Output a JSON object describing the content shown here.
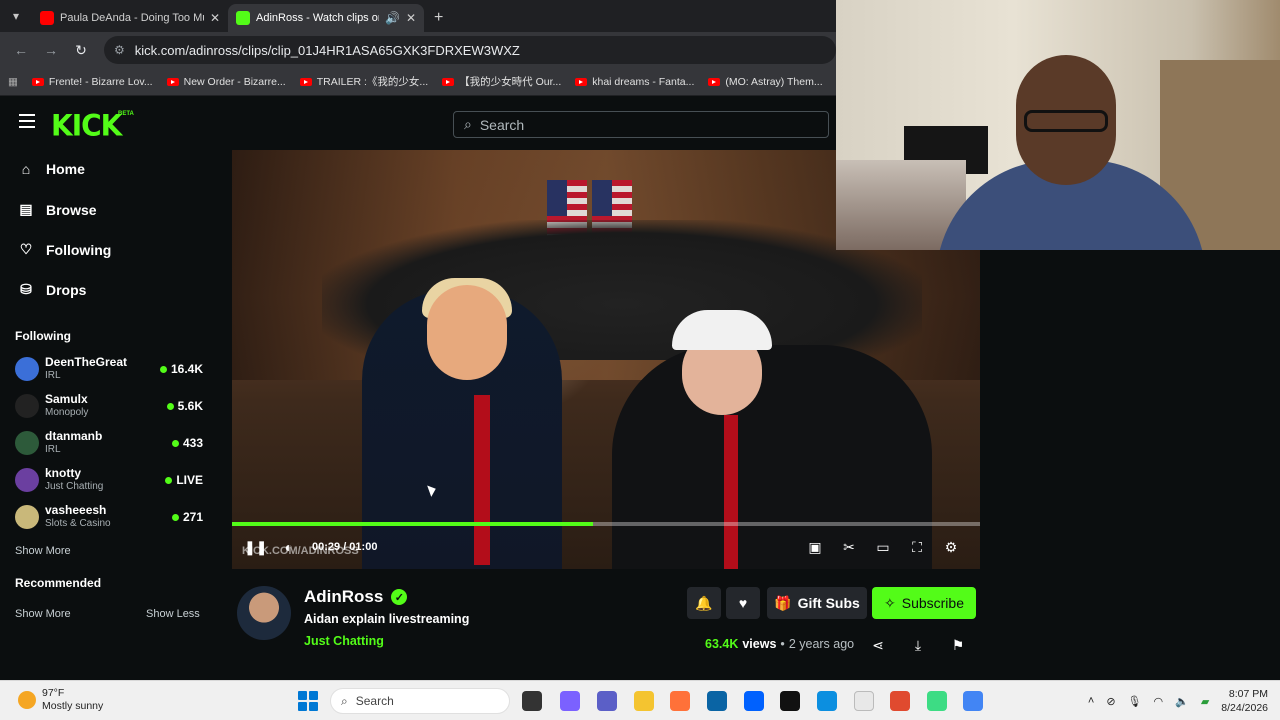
{
  "browser": {
    "tabs": [
      {
        "title": "Paula DeAnda - Doing Too Muc",
        "favicon_color": "#ff0000"
      },
      {
        "title": "AdinRoss - Watch clips on K",
        "favicon_color": "#53fc18"
      }
    ],
    "url": "kick.com/adinross/clips/clip_01J4HR1ASA65GXK3FDRXEW3WXZ",
    "bookmarks": [
      "Frente! - Bizarre Lov...",
      "New Order - Bizarre...",
      "TRAILER :《我的少女...",
      "【我的少女時代 Our...",
      "khai dreams - Fanta...",
      "(MO: Astray) Them..."
    ]
  },
  "kick": {
    "logo": "KICK",
    "beta": "BETA",
    "search_placeholder": "Search",
    "nav": [
      "Home",
      "Browse",
      "Following",
      "Drops"
    ],
    "following_title": "Following",
    "following": [
      {
        "name": "DeenTheGreat",
        "category": "IRL",
        "count": "16.4K",
        "avatar_color": "#3b6fd8"
      },
      {
        "name": "Samulx",
        "category": "Monopoly",
        "count": "5.6K",
        "avatar_color": "#222222"
      },
      {
        "name": "dtanmanb",
        "category": "IRL",
        "count": "433",
        "avatar_color": "#2d5a3a"
      },
      {
        "name": "knotty",
        "category": "Just Chatting",
        "count": "LIVE",
        "avatar_color": "#6b3fa0"
      },
      {
        "name": "vasheeesh",
        "category": "Slots & Casino",
        "count": "271",
        "avatar_color": "#c9b87a"
      }
    ],
    "show_more": "Show More",
    "recommended_title": "Recommended",
    "show_more_2": "Show More",
    "show_less": "Show Less"
  },
  "player": {
    "time": "00:29 / 01:00",
    "progress": 0.483,
    "watermark": "KICK.COM/ADINROSS"
  },
  "clip": {
    "channel": "AdinRoss",
    "title": "Aidan explain livestreaming",
    "category": "Just Chatting",
    "gift_subs": "Gift Subs",
    "subscribe": "Subscribe",
    "views_count": "63.4K",
    "views_label": "views",
    "separator": "•",
    "age": "2 years ago"
  },
  "taskbar": {
    "temp": "97°F",
    "weather": "Mostly sunny",
    "search": "Search",
    "time": "8:07 PM",
    "date": "8/24/2026"
  }
}
